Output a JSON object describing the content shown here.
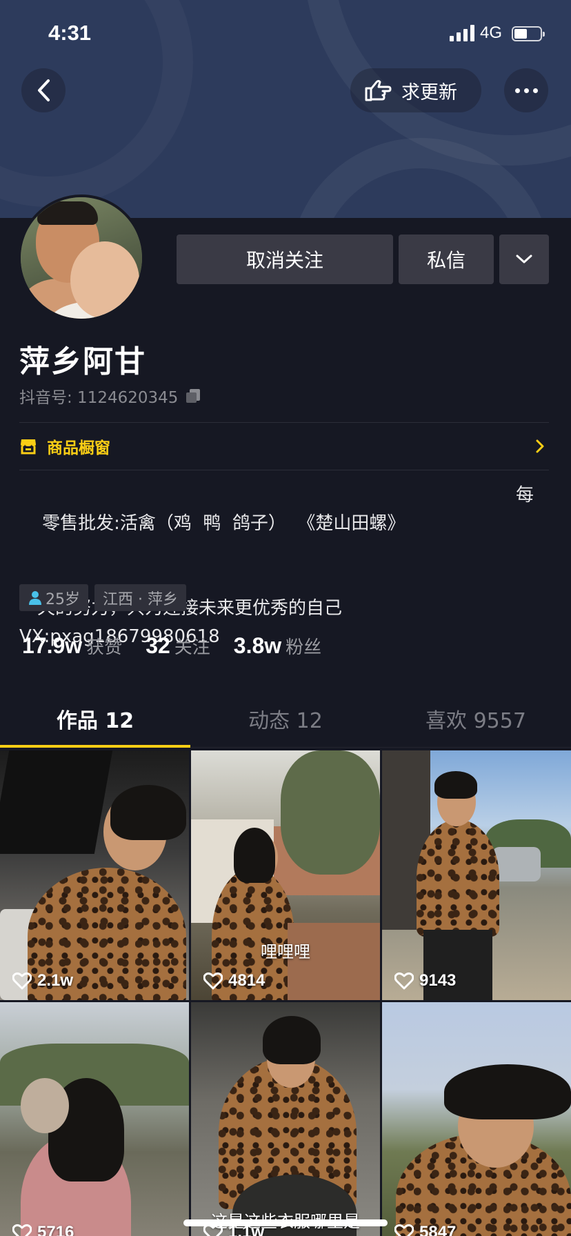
{
  "status_bar": {
    "time": "4:31",
    "network": "4G"
  },
  "header": {
    "update_label": "求更新"
  },
  "profile": {
    "unfollow_label": "取消关注",
    "message_label": "私信",
    "name": "萍乡阿甘",
    "douyin_id": "抖音号: 1124620345",
    "shop_label": "商品橱窗",
    "bio": {
      "line1": "零售批发:活禽（鸡  鸭  鸽子）  《楚山田螺》",
      "line1_tail": "每",
      "line2": "一天的努力，只为迎接未来更优秀的自己",
      "line3": "VX:pxag18679980618"
    },
    "tags": {
      "age": "25岁",
      "location": "江西 · 萍乡"
    },
    "stats": [
      {
        "value": "17.9w",
        "label": "获赞"
      },
      {
        "value": "32",
        "label": "关注"
      },
      {
        "value": "3.8w",
        "label": "粉丝"
      }
    ]
  },
  "tabs": [
    {
      "label": "作品 12",
      "active": true
    },
    {
      "label": "动态 12",
      "active": false
    },
    {
      "label": "喜欢 9557",
      "active": false
    }
  ],
  "videos": [
    {
      "likes": "2.1w",
      "caption": ""
    },
    {
      "likes": "4814",
      "caption": "哩哩哩"
    },
    {
      "likes": "9143",
      "caption": ""
    },
    {
      "likes": "5716",
      "caption": ""
    },
    {
      "likes": "1.1w",
      "caption": "这是这些衣服哪里是"
    },
    {
      "likes": "5847",
      "caption": ""
    }
  ],
  "colors": {
    "background": "#161823",
    "banner": "#2d3b5c",
    "accent": "#face15",
    "button": "#3a3a45"
  },
  "icons": [
    "back-icon",
    "hand-pointer-icon",
    "more-icon",
    "copy-icon",
    "shop-icon",
    "chevron-right-icon",
    "chevron-down-icon",
    "person-icon",
    "heart-icon"
  ]
}
